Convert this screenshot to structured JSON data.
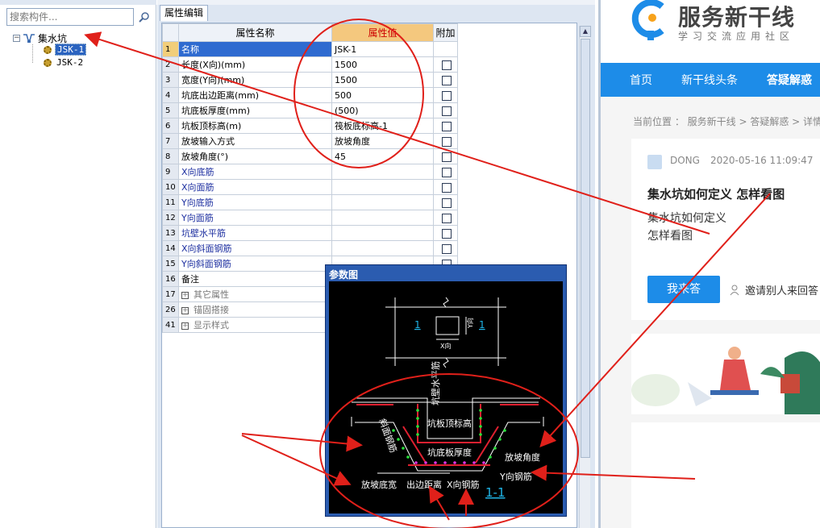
{
  "search": {
    "placeholder": "搜索构件..."
  },
  "tree": {
    "root_label": "集水坑",
    "children": [
      "JSK-1",
      "JSK-2"
    ]
  },
  "panel": {
    "tab_label": "属性编辑"
  },
  "grid": {
    "headers": [
      "属性名称",
      "属性值",
      "附加"
    ],
    "rows": [
      {
        "num": "1",
        "name": "名称",
        "value": "JSK-1",
        "check": false
      },
      {
        "num": "2",
        "name": "长度(X向)(mm)",
        "value": "1500",
        "check": true
      },
      {
        "num": "3",
        "name": "宽度(Y向)(mm)",
        "value": "1500",
        "check": true
      },
      {
        "num": "4",
        "name": "坑底出边距离(mm)",
        "value": "500",
        "check": true
      },
      {
        "num": "5",
        "name": "坑底板厚度(mm)",
        "value": "(500)",
        "check": true
      },
      {
        "num": "6",
        "name": "坑板顶标高(m)",
        "value": "筏板底标高-1",
        "check": true
      },
      {
        "num": "7",
        "name": "放坡输入方式",
        "value": "放坡角度",
        "check": true
      },
      {
        "num": "8",
        "name": "放坡角度(°)",
        "value": "45",
        "check": true
      },
      {
        "num": "9",
        "name": "X向底筋",
        "value": "",
        "check": true
      },
      {
        "num": "10",
        "name": "X向面筋",
        "value": "",
        "check": true
      },
      {
        "num": "11",
        "name": "Y向底筋",
        "value": "",
        "check": true
      },
      {
        "num": "12",
        "name": "Y向面筋",
        "value": "",
        "check": true
      },
      {
        "num": "13",
        "name": "坑壁水平筋",
        "value": "",
        "check": true
      },
      {
        "num": "14",
        "name": "X向斜面钢筋",
        "value": "",
        "check": true
      },
      {
        "num": "15",
        "name": "Y向斜面钢筋",
        "value": "",
        "check": true
      },
      {
        "num": "16",
        "name": "备注",
        "value": "",
        "check": false
      },
      {
        "num": "17",
        "name": "其它属性",
        "value": "",
        "check": false,
        "group": true
      },
      {
        "num": "26",
        "name": "锚固搭接",
        "value": "",
        "check": false,
        "group": true
      },
      {
        "num": "41",
        "name": "显示样式",
        "value": "",
        "check": false,
        "group": true
      }
    ]
  },
  "dialog": {
    "title": "参数图",
    "labels": {
      "num_left": "1",
      "num_right": "1",
      "x_dir": "X向",
      "y_dir": "Y向",
      "wall_horizontal": "坑壁水平筋",
      "top_elev": "坑板顶标高",
      "slab_thickness": "坑底板厚度",
      "slope_angle": "放坡角度",
      "y_rebar": "Y向钢筋",
      "slope_width": "放坡底宽",
      "edge_dist": "出边距离",
      "x_rebar": "X向钢筋",
      "slope_rebar": "斜面钢筋",
      "section": "1-1"
    }
  },
  "web": {
    "brand": "服务新干线",
    "slogan": "学习交流应用社区",
    "nav": [
      "首页",
      "新干线头条",
      "答疑解惑"
    ],
    "breadcrumb": "当前位置 ： 服务新干线 > 答疑解惑 > 详情",
    "author": "DONG",
    "time": "2020-05-16 11:09:47",
    "question_title": "集水坑如何定义 怎样看图",
    "question_body_1": "集水坑如何定义",
    "question_body_2": "怎样看图",
    "answer_button": "我来答",
    "invite": "邀请别人来回答"
  },
  "colors": {
    "annotation": "#e0201a",
    "nav_blue": "#1d8ce8",
    "selected": "#2f6bd0",
    "header_value": "#f4c87e"
  }
}
